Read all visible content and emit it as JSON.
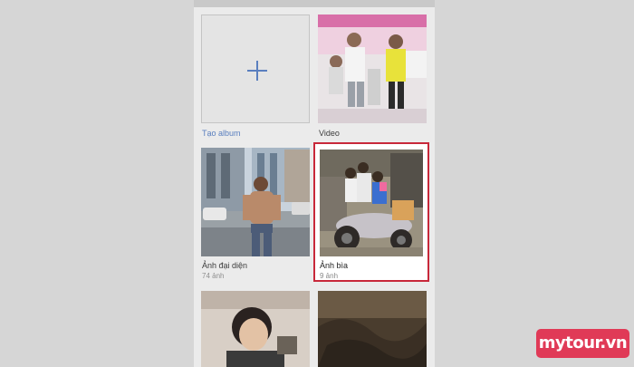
{
  "albums": [
    {
      "label": "Tạo album",
      "count": ""
    },
    {
      "label": "Video",
      "count": ""
    },
    {
      "label": "Ảnh đại diện",
      "count": "74 ảnh"
    },
    {
      "label": "Ảnh bìa",
      "count": "9 ảnh"
    }
  ],
  "brand": {
    "logo_text": "mytour.vn"
  },
  "colors": {
    "highlight": "#c8283a",
    "brand": "#e03a57",
    "create_accent": "#5a7fbf"
  }
}
